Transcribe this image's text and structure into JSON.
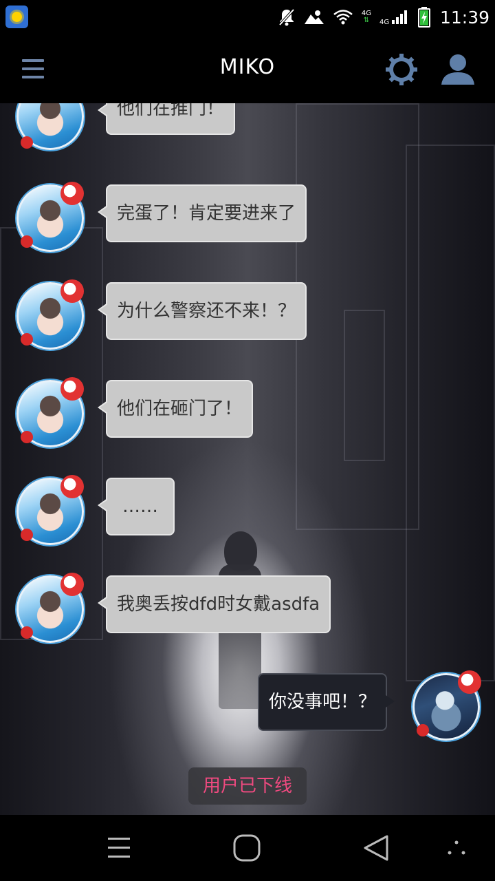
{
  "status_bar": {
    "time": "11:39",
    "network_label": "4G",
    "icons": [
      "weather-app-icon",
      "notifications-off-icon",
      "image-icon",
      "wifi-icon",
      "signal-icon",
      "battery-charging-icon"
    ]
  },
  "app_bar": {
    "title": "MIKO",
    "icons": [
      "menu-icon",
      "settings-gear-icon",
      "user-profile-icon"
    ],
    "accent_color": "#5f7fa8"
  },
  "messages": [
    {
      "direction": "incoming",
      "text": "他们在推门！"
    },
    {
      "direction": "incoming",
      "text": "完蛋了！肯定要进来了"
    },
    {
      "direction": "incoming",
      "text": "为什么警察还不来！？"
    },
    {
      "direction": "incoming",
      "text": "他们在砸门了！"
    },
    {
      "direction": "incoming",
      "text": "……"
    },
    {
      "direction": "incoming",
      "text": "我奥丢按dfd时女戴asdfa"
    },
    {
      "direction": "outgoing",
      "text": "你没事吧！？"
    }
  ],
  "offline_notice": "用户已下线",
  "nav_bar": {
    "icons": [
      "recent-apps-icon",
      "home-icon",
      "back-icon",
      "more-icon"
    ]
  },
  "colors": {
    "incoming_bubble": "#c9c9c9",
    "outgoing_bubble": "#1f2129",
    "offline_text": "#f04a80"
  }
}
